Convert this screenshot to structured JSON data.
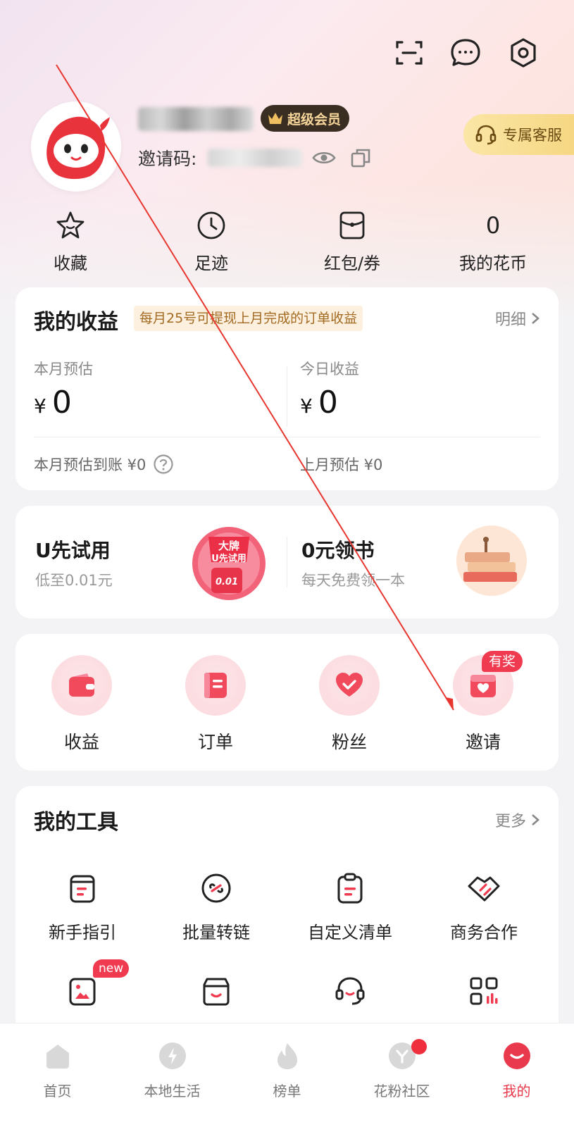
{
  "header": {
    "icons": [
      "scan-icon",
      "message-icon",
      "settings-icon"
    ]
  },
  "profile": {
    "vip_label": "超级会员",
    "invite_code_label": "邀请码:",
    "service_label": "专属客服"
  },
  "quick_links": [
    {
      "label": "收藏",
      "icon": "star-icon"
    },
    {
      "label": "足迹",
      "icon": "clock-icon"
    },
    {
      "label": "红包/券",
      "icon": "coupon-icon"
    },
    {
      "label": "我的花币",
      "value": "0"
    }
  ],
  "earnings": {
    "title": "我的收益",
    "note": "每月25号可提现上月完成的订单收益",
    "detail_label": "明细",
    "month_label": "本月预估",
    "month_value": "0",
    "today_label": "今日收益",
    "today_value": "0",
    "currency": "¥",
    "month_arrival": "本月预估到账 ¥0",
    "last_month": "上月预估 ¥0"
  },
  "promos": [
    {
      "title": "U先试用",
      "subtitle": "低至0.01元",
      "badge_line1": "大牌",
      "badge_line2": "U先试用",
      "badge_price": "0.01"
    },
    {
      "title": "0元领书",
      "subtitle": "每天免费领一本"
    }
  ],
  "functions": {
    "items": [
      {
        "label": "收益",
        "icon": "wallet-icon"
      },
      {
        "label": "订单",
        "icon": "order-icon"
      },
      {
        "label": "粉丝",
        "icon": "heart-icon"
      },
      {
        "label": "邀请",
        "icon": "invite-icon"
      }
    ],
    "prize_badge": "有奖"
  },
  "tools": {
    "title": "我的工具",
    "more_label": "更多",
    "items": [
      {
        "label": "新手指引",
        "icon": "guide-icon"
      },
      {
        "label": "批量转链",
        "icon": "link-icon"
      },
      {
        "label": "自定义清单",
        "icon": "clipboard-icon"
      },
      {
        "label": "商务合作",
        "icon": "handshake-icon"
      }
    ],
    "row2_icons": [
      "image-icon",
      "store-icon",
      "headset-icon",
      "grid-chart-icon"
    ],
    "new_badge": "new"
  },
  "bottom_nav": [
    {
      "label": "首页",
      "icon": "home-icon"
    },
    {
      "label": "本地生活",
      "icon": "lightning-icon"
    },
    {
      "label": "榜单",
      "icon": "flame-icon"
    },
    {
      "label": "花粉社区",
      "icon": "community-icon"
    },
    {
      "label": "我的",
      "icon": "profile-icon",
      "active": true
    }
  ],
  "colors": {
    "accent": "#ef3a4f",
    "vip_bg": "#3a2d22",
    "vip_text": "#f5d59a",
    "service_bg": "#f8dd8e"
  }
}
